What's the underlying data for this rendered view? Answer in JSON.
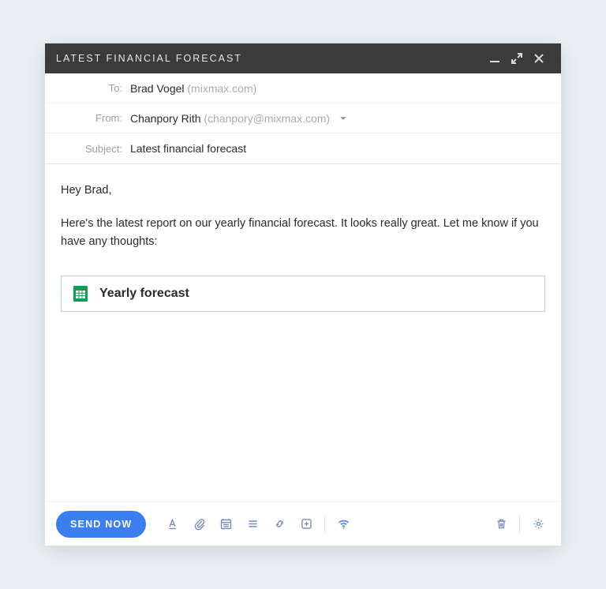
{
  "window": {
    "title": "LATEST FINANCIAL FORECAST"
  },
  "header": {
    "to_label": "To:",
    "to_name": "Brad Vogel",
    "to_domain": "(mixmax.com)",
    "from_label": "From:",
    "from_name": "Chanpory Rith",
    "from_email": "(chanpory@mixmax.com)",
    "subject_label": "Subject:",
    "subject_value": "Latest financial forecast"
  },
  "body": {
    "greeting": "Hey Brad,",
    "para1": "Here's the latest report on our yearly financial forecast. It looks really great. Let me know if you have any thoughts:"
  },
  "attachment": {
    "title": "Yearly forecast",
    "icon": "google-sheets-icon"
  },
  "toolbar": {
    "send_label": "SEND NOW"
  }
}
